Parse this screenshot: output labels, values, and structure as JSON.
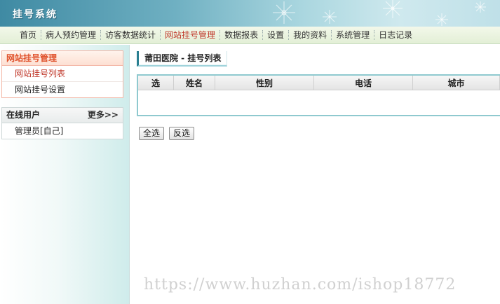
{
  "app": {
    "title": "挂号系统"
  },
  "nav": {
    "items": [
      {
        "label": "首页"
      },
      {
        "label": "病人预约管理"
      },
      {
        "label": "访客数据统计"
      },
      {
        "label": "网站挂号管理"
      },
      {
        "label": "数据报表"
      },
      {
        "label": "设置"
      },
      {
        "label": "我的资料"
      },
      {
        "label": "系统管理"
      },
      {
        "label": "日志记录"
      }
    ],
    "active_index": 3
  },
  "sidebar": {
    "panel1": {
      "title": "网站挂号管理",
      "items": [
        {
          "label": "网站挂号列表"
        },
        {
          "label": "网站挂号设置"
        }
      ],
      "active_index": 0
    },
    "panel2": {
      "title": "在线用户",
      "more": "更多>>",
      "items": [
        {
          "label": "管理员[自己]"
        }
      ]
    }
  },
  "main": {
    "title": "莆田医院 - 挂号列表",
    "table": {
      "headers": [
        "选",
        "姓名",
        "性别",
        "电话",
        "城市"
      ],
      "rows": []
    },
    "buttons": {
      "select_all": "全选",
      "invert": "反选"
    }
  },
  "watermark": "https://www.huzhan.com/ishop18772",
  "colors": {
    "accent": "#c0392b",
    "banner": "#3f8aa3",
    "border": "#8fc9cf"
  }
}
